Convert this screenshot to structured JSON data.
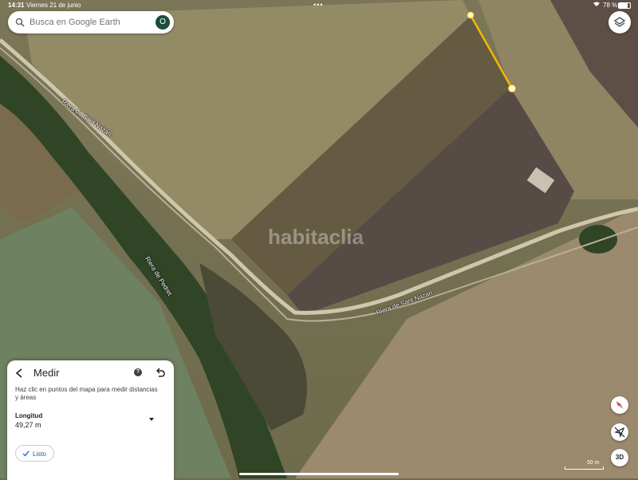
{
  "status_bar": {
    "time": "14:31",
    "date": "Viernes 21 de junio",
    "battery_percent": "78 %",
    "battery_level": 0.78
  },
  "search": {
    "placeholder": "Busca en Google Earth",
    "avatar_initial": "O",
    "avatar_color": "#1b4d3e"
  },
  "map": {
    "road_labels": [
      "Riera de Sant Nazari",
      "Riera de Pedret",
      "Riera de Sant Nazari"
    ],
    "watermark": "habitaclia",
    "measure_line_color": "#f5b800",
    "scale_label": "50 m"
  },
  "measure_panel": {
    "title": "Medir",
    "instructions": "Haz clic en puntos del mapa para medir distancias y áreas",
    "length_label": "Longitud",
    "length_value": "49,27 m",
    "done_label": "Listo"
  },
  "controls": {
    "three_d_label": "3D",
    "icons": [
      "layers-icon",
      "compass-icon",
      "location-off-icon",
      "search-icon",
      "back-icon",
      "help-icon",
      "undo-icon",
      "chevron-down-icon",
      "check-icon"
    ]
  }
}
